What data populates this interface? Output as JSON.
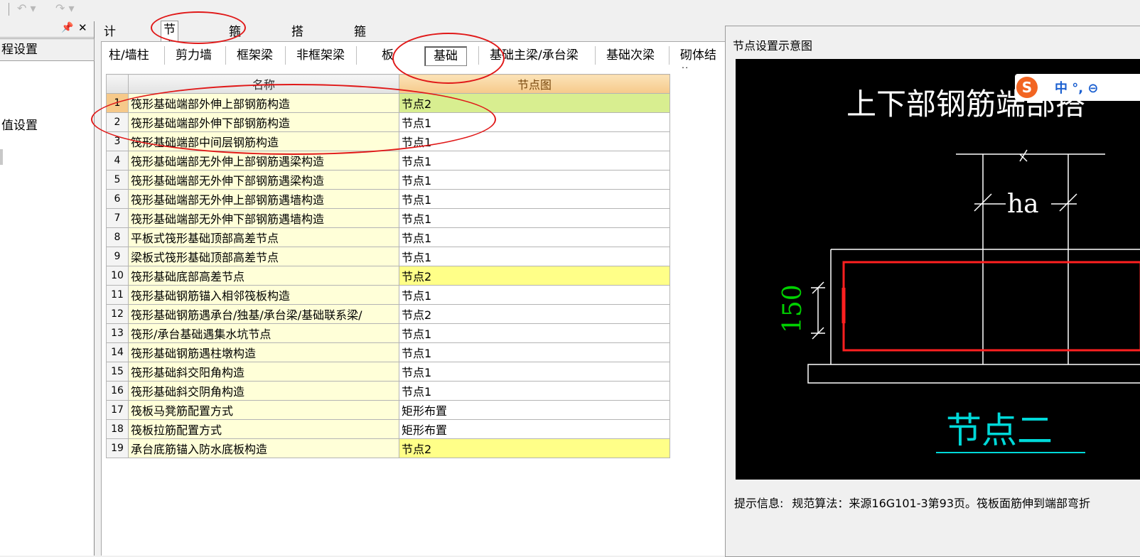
{
  "left_panel": {
    "pin_icon": "pin-icon",
    "close_icon": "close-icon",
    "title": "程设置",
    "item": "值设置"
  },
  "tabs": [
    "计算设置",
    "节点设置",
    "箍筋设置",
    "搭接设置",
    "箍筋公式"
  ],
  "active_tab": "节点设置",
  "subtabs": [
    "柱/墙柱",
    "剪力墙",
    "框架梁",
    "非框架梁",
    "板",
    "基础",
    "基础主梁/承台梁",
    "基础次梁",
    "砌体结构"
  ],
  "active_subtab": "基础",
  "grid": {
    "headers": {
      "name": "名称",
      "value": "节点图"
    },
    "rows": [
      {
        "no": "1",
        "name": "筏形基础端部外伸上部钢筋构造",
        "value": "节点2",
        "hl": "green"
      },
      {
        "no": "2",
        "name": "筏形基础端部外伸下部钢筋构造",
        "value": "节点1",
        "hl": ""
      },
      {
        "no": "3",
        "name": "筏形基础端部中间层钢筋构造",
        "value": "节点1",
        "hl": ""
      },
      {
        "no": "4",
        "name": "筏形基础端部无外伸上部钢筋遇梁构造",
        "value": "节点1",
        "hl": ""
      },
      {
        "no": "5",
        "name": "筏形基础端部无外伸下部钢筋遇梁构造",
        "value": "节点1",
        "hl": ""
      },
      {
        "no": "6",
        "name": "筏形基础端部无外伸上部钢筋遇墙构造",
        "value": "节点1",
        "hl": ""
      },
      {
        "no": "7",
        "name": "筏形基础端部无外伸下部钢筋遇墙构造",
        "value": "节点1",
        "hl": ""
      },
      {
        "no": "8",
        "name": "平板式筏形基础顶部高差节点",
        "value": "节点1",
        "hl": ""
      },
      {
        "no": "9",
        "name": "梁板式筏形基础顶部高差节点",
        "value": "节点1",
        "hl": ""
      },
      {
        "no": "10",
        "name": "筏形基础底部高差节点",
        "value": "节点2",
        "hl": "yellow"
      },
      {
        "no": "11",
        "name": "筏形基础钢筋锚入相邻筏板构造",
        "value": "节点1",
        "hl": ""
      },
      {
        "no": "12",
        "name": "筏形基础钢筋遇承台/独基/承台梁/基础联系梁/",
        "value": "节点2",
        "hl": ""
      },
      {
        "no": "13",
        "name": "筏形/承台基础遇集水坑节点",
        "value": "节点1",
        "hl": ""
      },
      {
        "no": "14",
        "name": "筏形基础钢筋遇柱墩构造",
        "value": "节点1",
        "hl": ""
      },
      {
        "no": "15",
        "name": "筏形基础斜交阳角构造",
        "value": "节点1",
        "hl": ""
      },
      {
        "no": "16",
        "name": "筏形基础斜交阴角构造",
        "value": "节点1",
        "hl": ""
      },
      {
        "no": "17",
        "name": "筏板马凳筋配置方式",
        "value": "矩形布置",
        "hl": ""
      },
      {
        "no": "18",
        "name": "筏板拉筋配置方式",
        "value": "矩形布置",
        "hl": ""
      },
      {
        "no": "19",
        "name": "承台底筋锚入防水底板构造",
        "value": "节点2",
        "hl": "yellow"
      }
    ]
  },
  "node_window": {
    "title": "节点设置示意图",
    "diagram_title": "上下部钢筋端部搭",
    "dim_ha": "ha",
    "dim_150": "150",
    "node_label": "节点二",
    "hint_label": "提示信息:",
    "hint_text": "规范算法：来源16G101-3第93页。筏板面筋伸到端部弯折"
  },
  "ime": {
    "logo": "S",
    "text": "中 °, ⊖"
  },
  "colors": {
    "annotation": "#e01818",
    "header_bg": "#f6c98a",
    "name_bg": "#ffffd8",
    "highlight_green": "#d8ee90",
    "highlight_yellow": "#ffff88",
    "canvas_bg": "#000000",
    "rebar_red": "#ff2020",
    "dim_green": "#00d000",
    "label_cyan": "#00d8d8"
  }
}
